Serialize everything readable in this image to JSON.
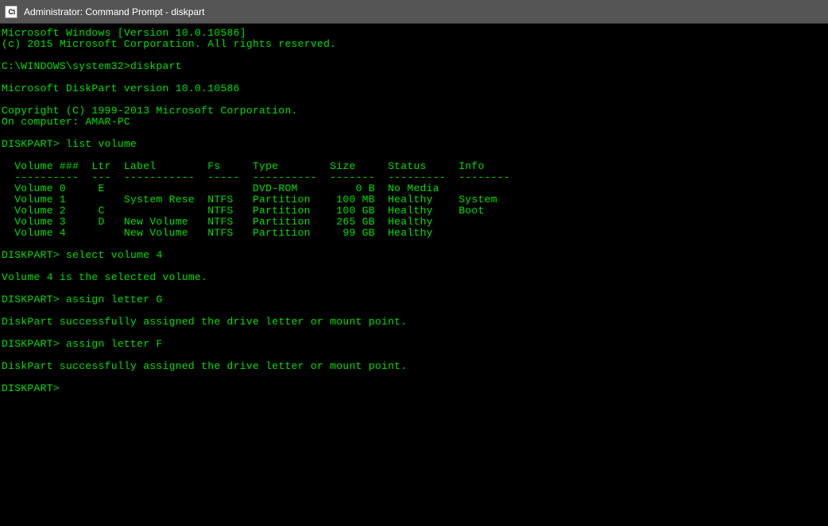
{
  "titlebar": {
    "icon_label": "C:\\",
    "title": "Administrator: Command Prompt - diskpart"
  },
  "header": {
    "windows_version": "Microsoft Windows [Version 10.0.10586]",
    "copyright": "(c) 2015 Microsoft Corporation. All rights reserved."
  },
  "shell_prompt": "C:\\WINDOWS\\system32>",
  "initial_command": "diskpart",
  "diskpart_header": {
    "version": "Microsoft DiskPart version 10.0.10586",
    "copyright": "Copyright (C) 1999-2013 Microsoft Corporation.",
    "computer": "On computer: AMAR-PC"
  },
  "dp_prompt": "DISKPART>",
  "cmd_list_volume": "list volume",
  "table": {
    "header": "  Volume ###  Ltr  Label        Fs     Type        Size     Status     Info",
    "divider": "  ----------  ---  -----------  -----  ----------  -------  ---------  --------",
    "rows": {
      "r0": "  Volume 0     E                       DVD-ROM         0 B  No Media",
      "r1": "  Volume 1         System Rese  NTFS   Partition    100 MB  Healthy    System",
      "r2": "  Volume 2     C                NTFS   Partition    100 GB  Healthy    Boot",
      "r3": "  Volume 3     D   New Volume   NTFS   Partition    265 GB  Healthy",
      "r4": "  Volume 4         New Volume   NTFS   Partition     99 GB  Healthy"
    }
  },
  "cmd_select_volume": "select volume 4",
  "msg_selected": "Volume 4 is the selected volume.",
  "cmd_assign_g": "assign letter G",
  "msg_assigned_g": "DiskPart successfully assigned the drive letter or mount point.",
  "cmd_assign_f": "assign letter F",
  "msg_assigned_f": "DiskPart successfully assigned the drive letter or mount point."
}
